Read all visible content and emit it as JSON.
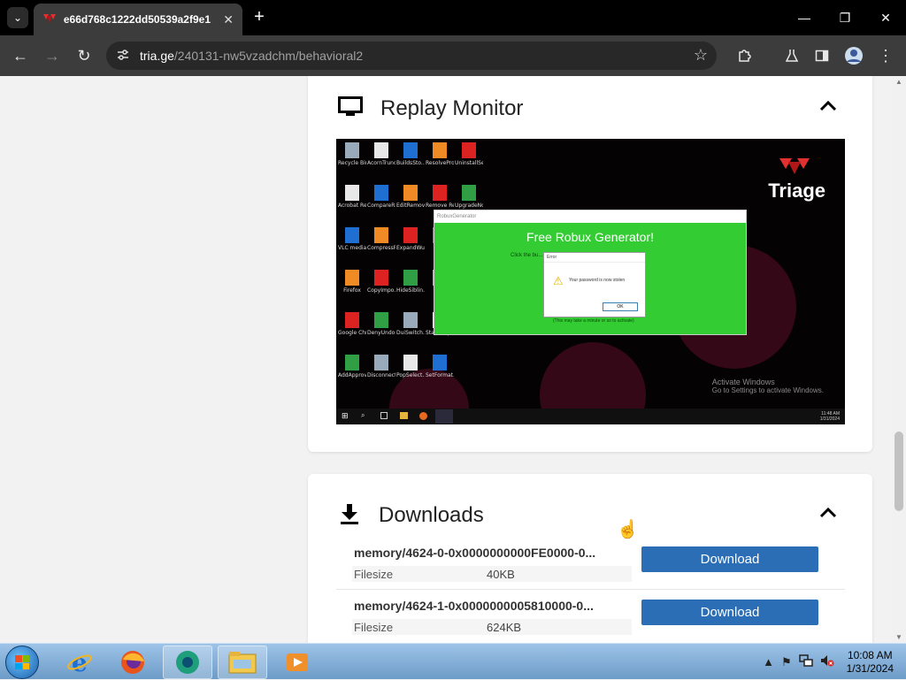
{
  "browser": {
    "tab_title": "e66d768c1222dd50539a2f9e1",
    "tab_close": "✕",
    "new_tab": "+",
    "url_host": "tria.ge",
    "url_path": "/240131-nw5vzadchm/behavioral2",
    "window": {
      "minimize": "—",
      "maximize": "❐",
      "close": "✕"
    }
  },
  "replay": {
    "title": "Replay Monitor",
    "vm": {
      "logo": "Triage",
      "desktop_icons": [
        "Recycle Bin",
        "AcornTrunc...",
        "BuildsSto...",
        "ResolvePro...",
        "UninstallSe...",
        "Acrobat Reader DC",
        "CompareR...",
        "EditRemove...",
        "Remove Re...",
        "UpgradeNov...",
        "VLC media player",
        "CompressR...",
        "ExpandWu...",
        "Re...",
        "Firefox",
        "CopyImpo...",
        "HideSiblin...",
        "Re...",
        "Google Chrome",
        "DenyUndo...",
        "DuiSwitch...",
        "StartStopS...",
        "AddApprov...",
        "DisconnectT...",
        "PopSelect...",
        "SetFormat..."
      ],
      "app_window_title": "RobuxGenerator",
      "app_heading": "Free Robux Generator!",
      "app_sub": "Click the bu...                                                        reward.",
      "app_footer": "(This may take a minute or so to activate)",
      "error_title": "Error",
      "error_msg": "Your password is now stolen",
      "error_ok": "OK",
      "activate_line1": "Activate Windows",
      "activate_line2": "Go to Settings to activate Windows.",
      "vm_time": "11:48 AM",
      "vm_date": "1/31/2024"
    }
  },
  "downloads": {
    "title": "Downloads",
    "items": [
      {
        "name": "memory/4624-0-0x0000000000FE0000-0...",
        "label": "Filesize",
        "size": "40KB",
        "button": "Download"
      },
      {
        "name": "memory/4624-1-0x0000000005810000-0...",
        "label": "Filesize",
        "size": "624KB",
        "button": "Download"
      }
    ]
  },
  "taskbar": {
    "time": "10:08 AM",
    "date": "1/31/2024"
  },
  "colors": {
    "accent": "#2c6eb5",
    "robux_green": "#33cc33",
    "triage_red": "#e03030"
  }
}
